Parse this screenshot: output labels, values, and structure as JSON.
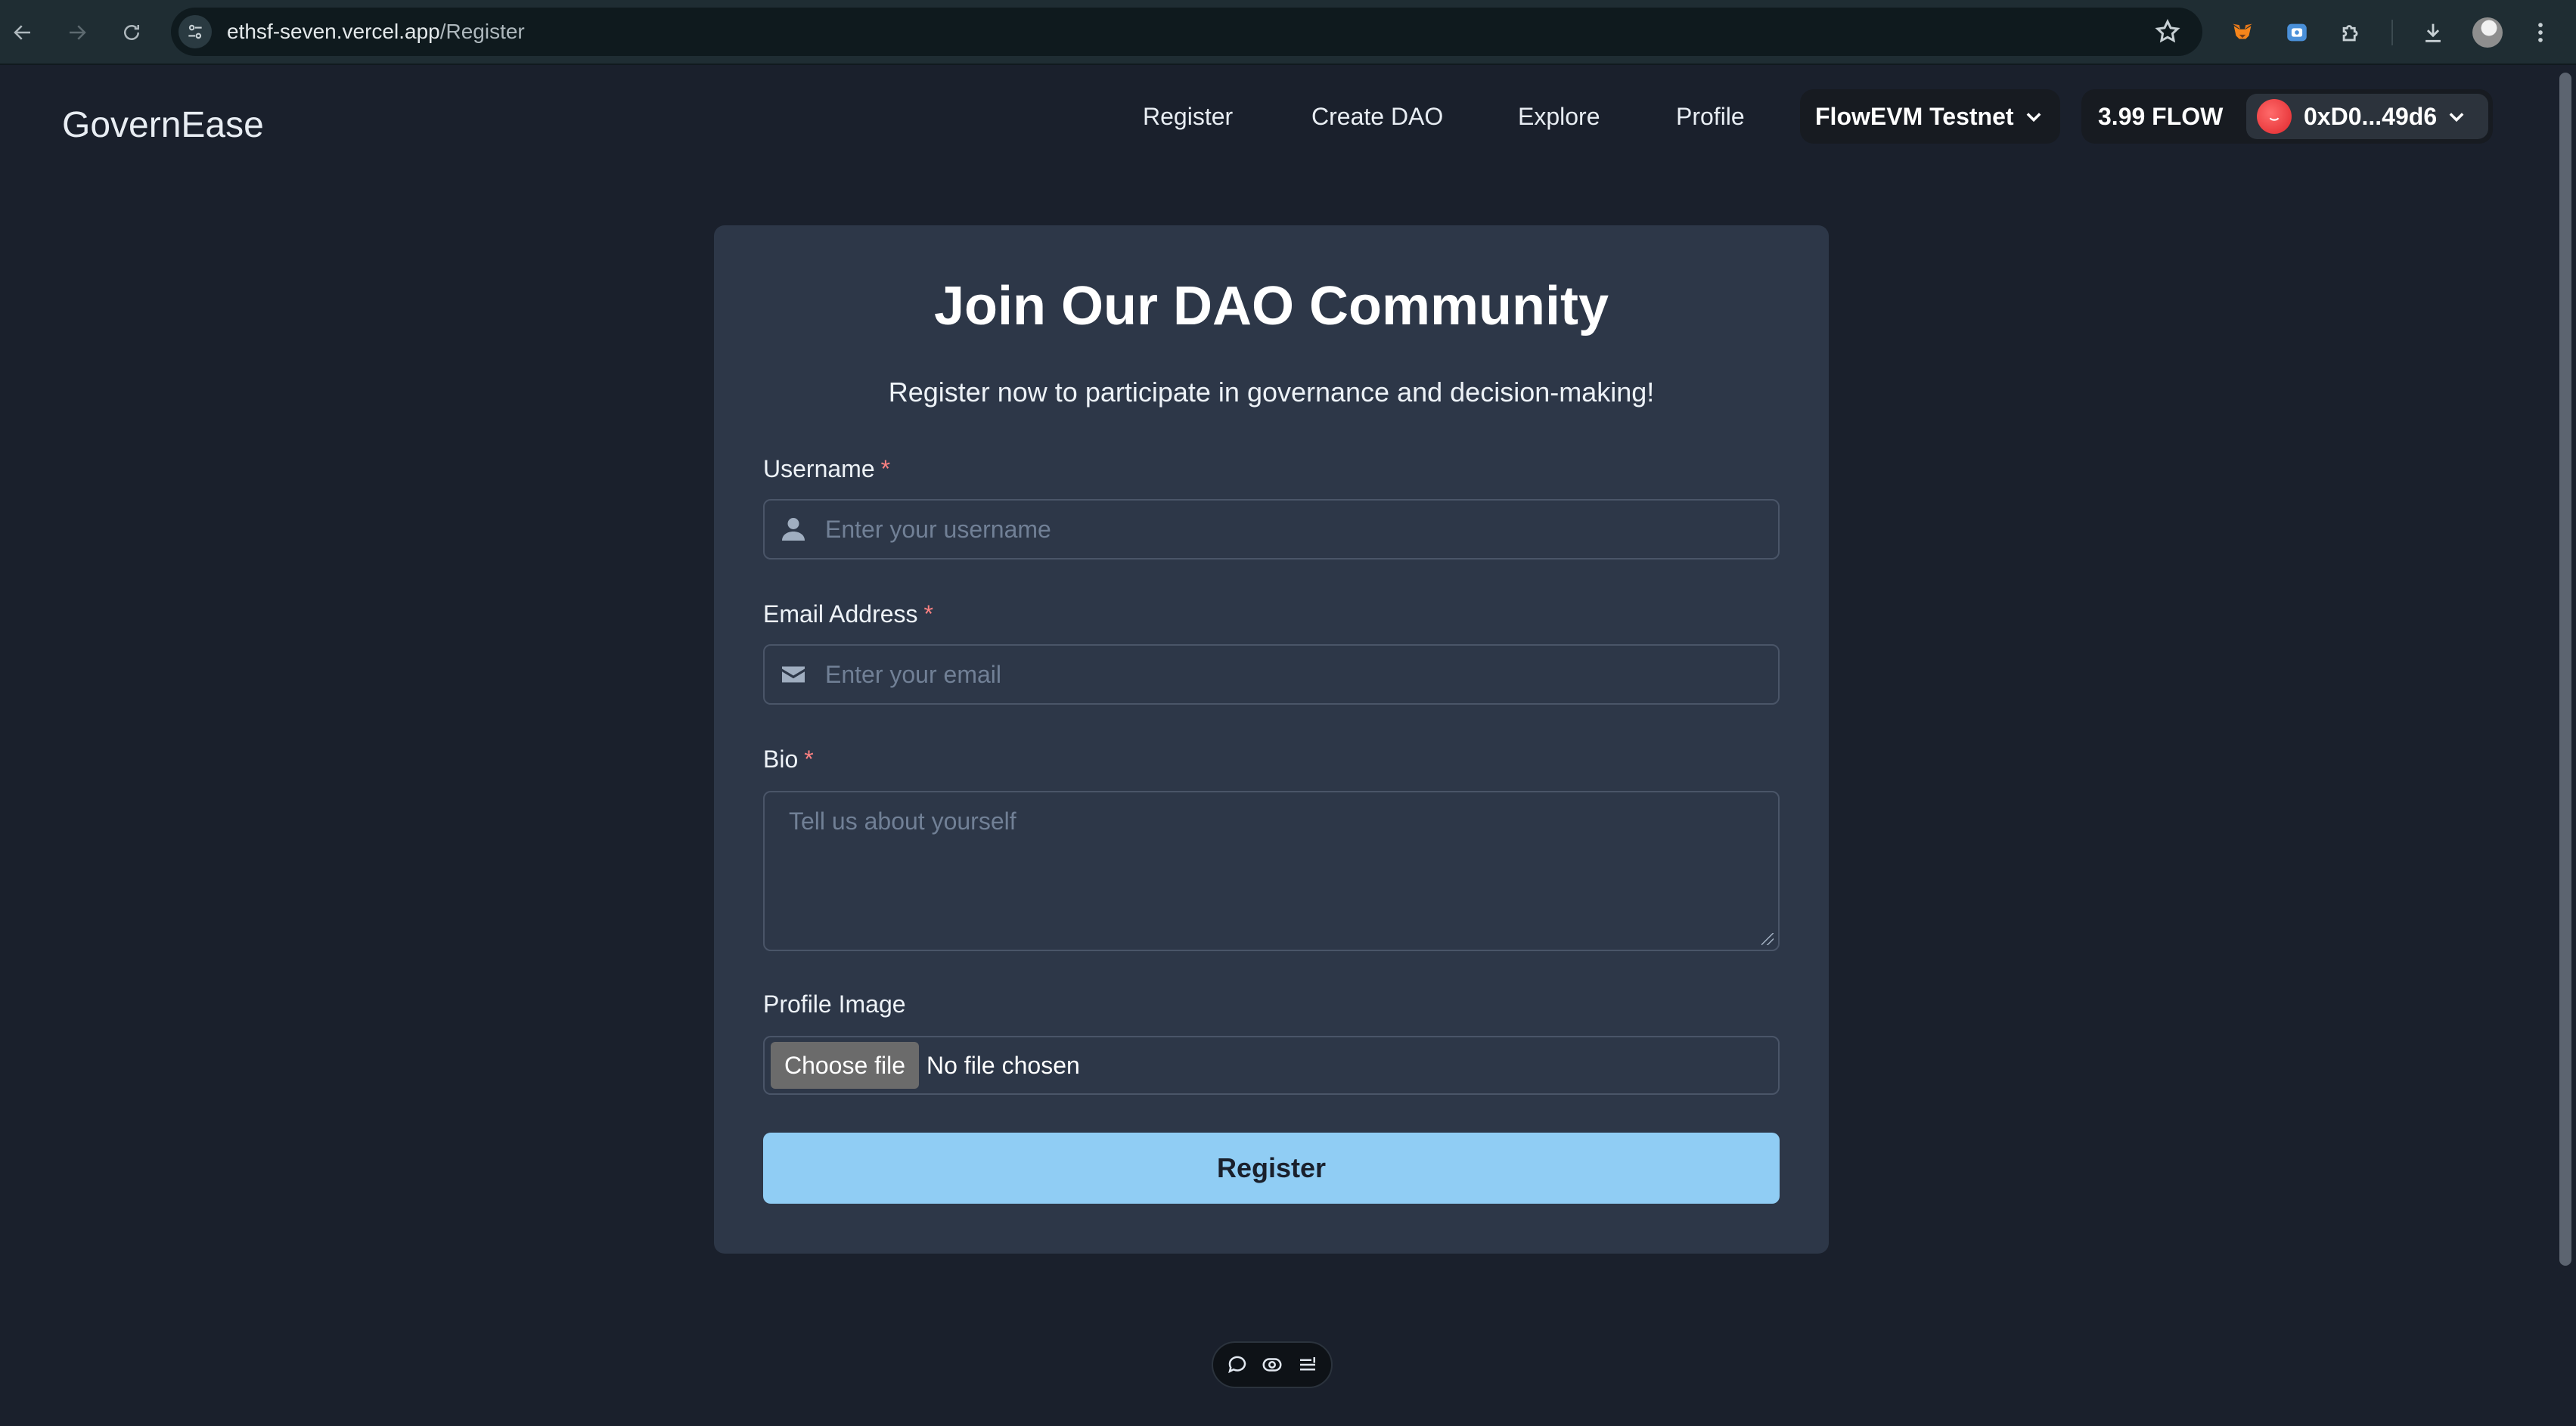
{
  "browser": {
    "url_domain": "ethsf-seven.vercel.app",
    "url_path": "/Register",
    "icons": {
      "back": "arrow-left-icon",
      "forward": "arrow-right-icon",
      "reload": "reload-icon",
      "site_info": "tune-icon",
      "bookmark": "star-icon",
      "extensions": [
        "metamask-fox-icon",
        "camera-extension-icon",
        "puzzle-icon"
      ],
      "download": "download-icon",
      "profile": "profile-avatar",
      "menu": "kebab-menu-icon"
    }
  },
  "header": {
    "logo": "GovernEase",
    "nav": [
      "Register",
      "Create DAO",
      "Explore",
      "Profile"
    ],
    "network": "FlowEVM Testnet",
    "balance": "3.99 FLOW",
    "account": "0xD0...49d6"
  },
  "form": {
    "title": "Join Our DAO Community",
    "subtitle": "Register now to participate in governance and decision-making!",
    "username": {
      "label": "Username",
      "required_mark": "*",
      "placeholder": "Enter your username",
      "value": ""
    },
    "email": {
      "label": "Email Address",
      "required_mark": "*",
      "placeholder": "Enter your email",
      "value": ""
    },
    "bio": {
      "label": "Bio",
      "required_mark": "*",
      "placeholder": "Tell us about yourself",
      "value": ""
    },
    "profile_image": {
      "label": "Profile Image",
      "button": "Choose file",
      "status": "No file chosen"
    },
    "submit": "Register"
  },
  "colors": {
    "page_bg": "#1a202c",
    "card_bg": "#2d3748",
    "accent": "#90cdf4",
    "required": "#fc8181"
  },
  "floating_toolbar": {
    "icons": [
      "comment-icon",
      "eye-toggle-icon",
      "list-settings-icon"
    ]
  }
}
